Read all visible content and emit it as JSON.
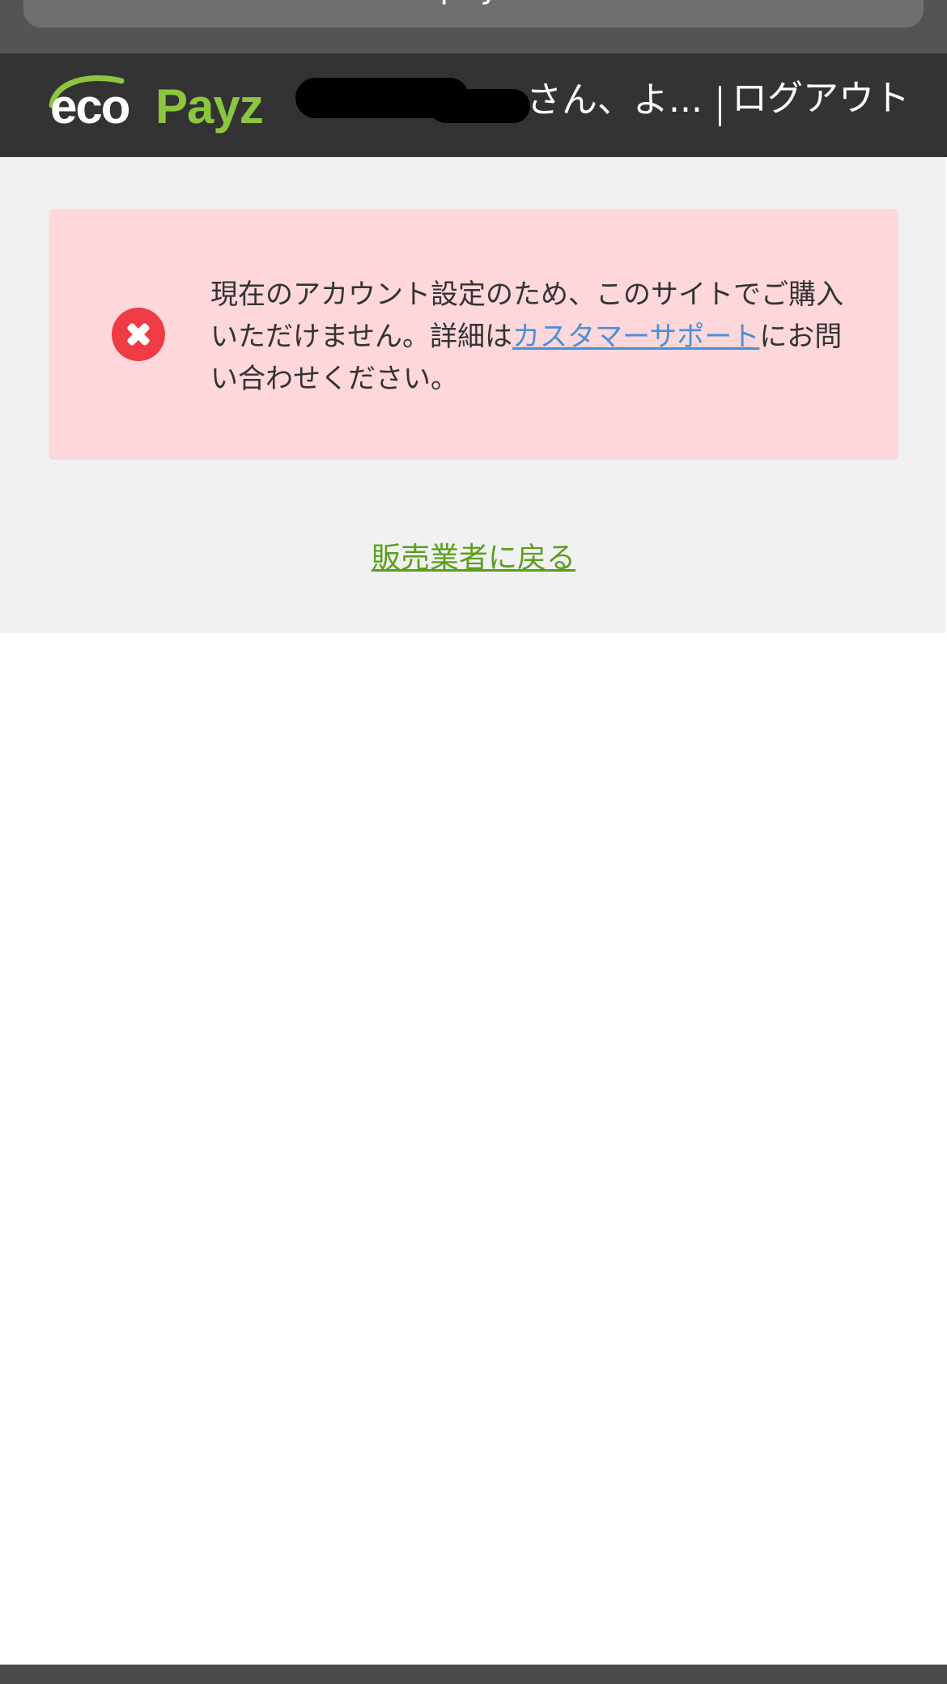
{
  "browser": {
    "url": "...ecopayz.com"
  },
  "header": {
    "logo": {
      "text_eco": "eco",
      "text_payz": "Payz"
    },
    "greeting": "さん、よ...",
    "logout_label": "ログアウト"
  },
  "error": {
    "message_before_link": "現在のアカウント設定のため、このサイトでご購入いただけません。詳細は",
    "link_text": "カスタマーサポート",
    "message_after_link": "にお問い合わせください。"
  },
  "actions": {
    "back_label": "販売業者に戻る"
  },
  "colors": {
    "brand_green": "#8cc63f",
    "error_bg": "#fdd7da",
    "error_icon": "#ef3c44",
    "link_blue": "#4a90d6",
    "back_link_green": "#5a9f1a",
    "header_bg": "#333333"
  }
}
